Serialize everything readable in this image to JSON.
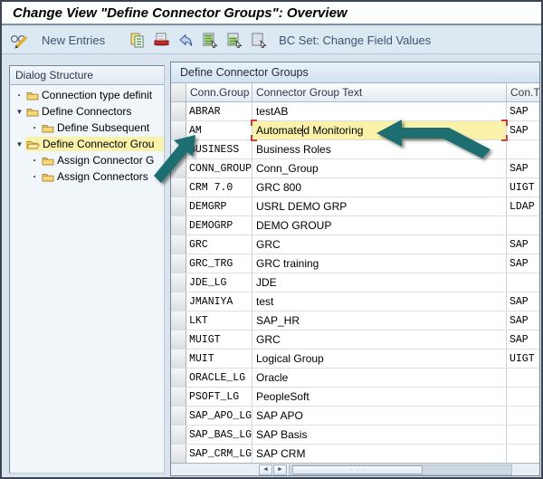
{
  "window": {
    "title": "Change View \"Define Connector Groups\": Overview"
  },
  "toolbar": {
    "new_entries_label": "New Entries",
    "bc_set_label": "BC Set: Change Field Values"
  },
  "icons": {
    "tree_expanded_glyph": "▼",
    "tree_leaf_glyph": "·",
    "scroll_left_glyph": "◄",
    "scroll_right_glyph": "►",
    "thumb_grip_glyph": "· · ·"
  },
  "sidebar": {
    "header": "Dialog Structure",
    "items": [
      {
        "label": "Connection type definit",
        "indent": 0,
        "marker": "leaf",
        "selected": false
      },
      {
        "label": "Define Connectors",
        "indent": 0,
        "marker": "expanded",
        "selected": false
      },
      {
        "label": "Define Subsequent",
        "indent": 1,
        "marker": "leaf",
        "selected": false
      },
      {
        "label": "Define Connector Grou",
        "indent": 0,
        "marker": "expanded",
        "selected": true
      },
      {
        "label": "Assign Connector G",
        "indent": 1,
        "marker": "leaf",
        "selected": false
      },
      {
        "label": "Assign Connectors",
        "indent": 1,
        "marker": "leaf",
        "selected": false
      }
    ]
  },
  "table": {
    "title": "Define Connector Groups",
    "columns": {
      "group": "Conn.Group",
      "text": "Connector Group Text",
      "type": "Con.T"
    },
    "caret": {
      "before": "Automate",
      "after": "d Monitoring"
    },
    "rows": [
      {
        "group": "ABRAR",
        "text": "testAB",
        "type": "SAP",
        "highlighted": false
      },
      {
        "group": "AM",
        "text": "Automated Monitoring",
        "type": "SAP",
        "highlighted": true
      },
      {
        "group": "BUSINESS",
        "text": "Business Roles",
        "type": "",
        "highlighted": false
      },
      {
        "group": "CONN_GROUP",
        "text": "Conn_Group",
        "type": "SAP",
        "highlighted": false
      },
      {
        "group": "CRM 7.0",
        "text": "GRC 800",
        "type": "UIGT",
        "highlighted": false
      },
      {
        "group": "DEMGRP",
        "text": "USRL DEMO GRP",
        "type": "LDAP",
        "highlighted": false
      },
      {
        "group": "DEMOGRP",
        "text": "DEMO GROUP",
        "type": "",
        "highlighted": false
      },
      {
        "group": "GRC",
        "text": "GRC",
        "type": "SAP",
        "highlighted": false
      },
      {
        "group": "GRC_TRG",
        "text": "GRC training",
        "type": "SAP",
        "highlighted": false
      },
      {
        "group": "JDE_LG",
        "text": "JDE",
        "type": "",
        "highlighted": false
      },
      {
        "group": "JMANIYA",
        "text": "test",
        "type": "SAP",
        "highlighted": false
      },
      {
        "group": "LKT",
        "text": "SAP_HR",
        "type": "SAP",
        "highlighted": false
      },
      {
        "group": "MUIGT",
        "text": "GRC",
        "type": "SAP",
        "highlighted": false
      },
      {
        "group": "MUIT",
        "text": "Logical Group",
        "type": "UIGT",
        "highlighted": false
      },
      {
        "group": "ORACLE_LG",
        "text": "Oracle",
        "type": "",
        "highlighted": false
      },
      {
        "group": "PSOFT_LG",
        "text": "PeopleSoft",
        "type": "",
        "highlighted": false
      },
      {
        "group": "SAP_APO_LG",
        "text": "SAP APO",
        "type": "",
        "highlighted": false
      },
      {
        "group": "SAP_BAS_LG",
        "text": "SAP Basis",
        "type": "",
        "highlighted": false
      },
      {
        "group": "SAP_CRM_LG",
        "text": "SAP CRM",
        "type": "",
        "highlighted": false
      }
    ]
  },
  "colors": {
    "highlight_yellow": "#fbf2aa",
    "selection_red": "#cf3a3a",
    "annotation_teal": "#1e6e71"
  }
}
